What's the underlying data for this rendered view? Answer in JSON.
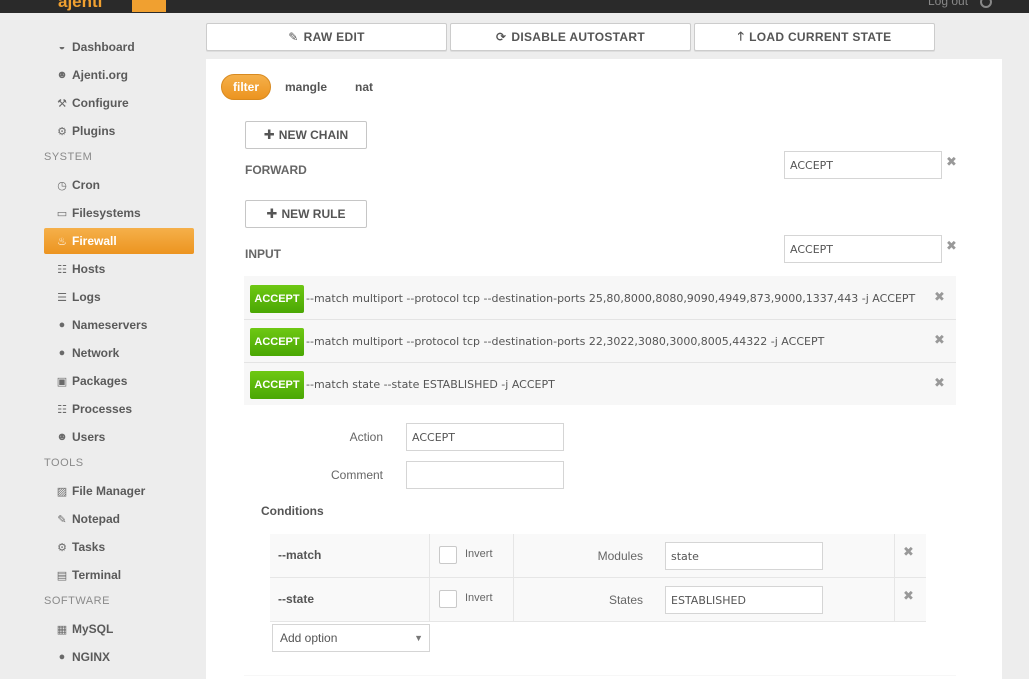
{
  "app": {
    "logo": "ajenti",
    "logout_label": "Log out"
  },
  "sidebar": {
    "items": [
      {
        "label": "Dashboard",
        "icon": "dashboard-icon",
        "glyph": "◒"
      },
      {
        "label": "Ajenti.org",
        "icon": "users-icon",
        "glyph": "☻"
      },
      {
        "label": "Configure",
        "icon": "wrench-icon",
        "glyph": "⚒"
      },
      {
        "label": "Plugins",
        "icon": "cogs-icon",
        "glyph": "⚙"
      }
    ],
    "sections": [
      {
        "title": "SYSTEM",
        "items": [
          {
            "label": "Cron",
            "icon": "clock-icon",
            "glyph": "◷"
          },
          {
            "label": "Filesystems",
            "icon": "hdd-icon",
            "glyph": "▭"
          },
          {
            "label": "Firewall",
            "icon": "fire-icon",
            "glyph": "♨",
            "active": true
          },
          {
            "label": "Hosts",
            "icon": "sitemap-icon",
            "glyph": "☷"
          },
          {
            "label": "Logs",
            "icon": "list-icon",
            "glyph": "☰"
          },
          {
            "label": "Nameservers",
            "icon": "globe-icon",
            "glyph": "●"
          },
          {
            "label": "Network",
            "icon": "globe-icon",
            "glyph": "●"
          },
          {
            "label": "Packages",
            "icon": "gift-icon",
            "glyph": "▣"
          },
          {
            "label": "Processes",
            "icon": "table-icon",
            "glyph": "☷"
          },
          {
            "label": "Users",
            "icon": "group-icon",
            "glyph": "☻"
          }
        ]
      },
      {
        "title": "TOOLS",
        "items": [
          {
            "label": "File Manager",
            "icon": "folder-open-icon",
            "glyph": "▨"
          },
          {
            "label": "Notepad",
            "icon": "edit-icon",
            "glyph": "✎"
          },
          {
            "label": "Tasks",
            "icon": "cog-icon",
            "glyph": "⚙"
          },
          {
            "label": "Terminal",
            "icon": "terminal-icon",
            "glyph": "▤"
          }
        ]
      },
      {
        "title": "SOFTWARE",
        "items": [
          {
            "label": "MySQL",
            "icon": "table-icon",
            "glyph": "▦"
          },
          {
            "label": "NGINX",
            "icon": "globe-icon",
            "glyph": "●"
          }
        ]
      }
    ]
  },
  "toolbar": {
    "raw_edit": "RAW EDIT",
    "disable_autostart": "DISABLE AUTOSTART",
    "load_current_state": "LOAD CURRENT STATE"
  },
  "tabs": [
    "filter",
    "mangle",
    "nat"
  ],
  "active_tab": "filter",
  "new_chain_label": "NEW CHAIN",
  "new_rule_label": "NEW RULE",
  "chains": [
    {
      "name": "FORWARD",
      "policy": "ACCEPT"
    },
    {
      "name": "INPUT",
      "policy": "ACCEPT"
    }
  ],
  "rules": [
    {
      "action": "ACCEPT",
      "text": "--match multiport --protocol tcp --destination-ports 25,80,8000,8080,9090,4949,873,9000,1337,443 -j ACCEPT"
    },
    {
      "action": "ACCEPT",
      "text": "--match multiport --protocol tcp --destination-ports 22,3022,3080,3000,8005,44322 -j ACCEPT"
    },
    {
      "action": "ACCEPT",
      "text": "--match state --state ESTABLISHED -j ACCEPT"
    }
  ],
  "rule_detail": {
    "action_label": "Action",
    "action_value": "ACCEPT",
    "comment_label": "Comment",
    "comment_value": "",
    "conditions_title": "Conditions",
    "conditions": [
      {
        "name": "--match",
        "invert_label": "Invert",
        "field_label": "Modules",
        "field_value": "state"
      },
      {
        "name": "--state",
        "invert_label": "Invert",
        "field_label": "States",
        "field_value": "ESTABLISHED"
      }
    ],
    "add_option_label": "Add option"
  },
  "colors": {
    "accent": "#f0a030",
    "accept_badge": "#5ab80b",
    "topbar": "#2a2a2a"
  }
}
